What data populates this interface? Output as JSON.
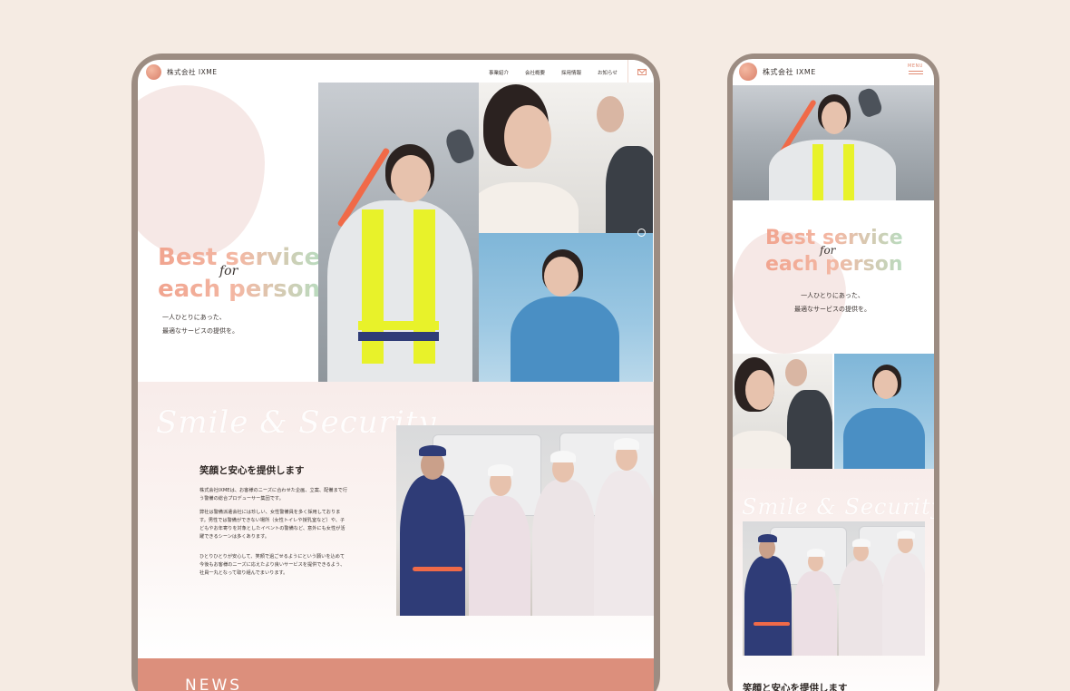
{
  "tablet": {
    "logo_text": "株式会社 IXME",
    "nav": [
      "事業紹介",
      "会社概要",
      "採用情報",
      "お知らせ"
    ],
    "hero": {
      "title_line1": "Best service",
      "title_for": "for",
      "title_line2": "each person",
      "sub_line1": "一人ひとりにあった、",
      "sub_line2": "最適なサービスの提供を。"
    },
    "about": {
      "script": "Smile & Security",
      "title": "笑顔と安心を提供します",
      "p1": "株式会社IXMEは、お客様のニーズに合わせた企画、立案、配備まで行う警備の総合プロデューサー集団です。",
      "p2": "弊社は警備派遣会社には珍しい、女性警備員を多く採用しております。男性では警備ができない場所（女性トイレや授乳室など）や、子どもやお年寄りを対象としたイベントの警備など、意外にも女性が活躍できるシーンは多くあります。",
      "p3": "ひとりひとりが安心して、笑顔で過ごせるようにという願いを込めて今後もお客様のニーズに応えたより良いサービスを提供できるよう、社員一丸となって取り組んでまいります。"
    },
    "news_title": "NEWS"
  },
  "phone": {
    "logo_text": "株式会社 IXME",
    "menu_label": "MENU",
    "hero": {
      "title_line1": "Best service",
      "title_for": "for",
      "title_line2": "each person",
      "sub_line1": "一人ひとりにあった、",
      "sub_line2": "最適なサービスの提供を。"
    },
    "about": {
      "script": "Smile & Security",
      "title": "笑顔と安心を提供します"
    }
  },
  "colors": {
    "background": "#f5ebe3",
    "frame": "#9c8c82",
    "accent": "#dc8f7c",
    "title_gradient_start": "#f1a48f",
    "title_gradient_end": "#b9dbbf"
  },
  "icons": [
    "logo-mark-icon",
    "mail-icon",
    "menu-icon",
    "scroll-icon"
  ]
}
